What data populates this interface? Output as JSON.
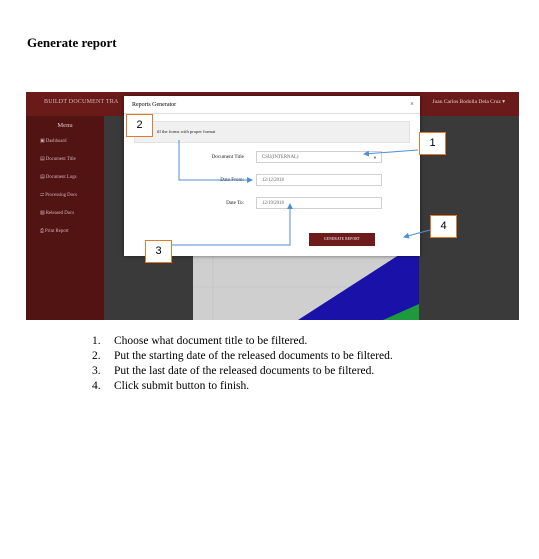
{
  "doc_heading": "Generate report",
  "app": {
    "brand": "BUILDT DOCUMENT TRA",
    "user": "Juan Carlos Bodolla Dela Cruz ▾",
    "menu_title": "Menu",
    "sidebar_items": [
      {
        "icon": "dashboard-icon",
        "glyph": "▣",
        "label": "Dashboard"
      },
      {
        "icon": "document-title-icon",
        "glyph": "▤",
        "label": "Document Title"
      },
      {
        "icon": "document-logs-icon",
        "glyph": "▤",
        "label": "Document Logs"
      },
      {
        "icon": "processing-icon",
        "glyph": "⇄",
        "label": "Processing Docs"
      },
      {
        "icon": "released-icon",
        "glyph": "▧",
        "label": "Released Docs"
      },
      {
        "icon": "print-icon",
        "glyph": "⎙",
        "label": "Print Report"
      }
    ]
  },
  "modal": {
    "title": "Reports Generator",
    "close": "×",
    "notice": "ill the forms with proper format",
    "document_title_label": "Document Title",
    "document_title_value": "CSU(INTERNAL)",
    "date_from_label": "Date From:",
    "date_from_value": "12/12/2018",
    "date_to_label": "Date To:",
    "date_to_value": "12/19/2018",
    "generate_button": "GENERATE REPORT"
  },
  "colors": {
    "maroon": "#6b1a1a",
    "callout_border": "#e07b2e",
    "arrow": "#4f8fd6",
    "chart_blue": "#1a12a8",
    "chart_green": "#1e9a3c"
  },
  "callouts": [
    "1",
    "2",
    "3",
    "4"
  ],
  "steps": [
    {
      "num": "1.",
      "text": "Choose what document title to be filtered."
    },
    {
      "num": "2.",
      "text": "Put the starting date of the released documents to be filtered."
    },
    {
      "num": "3.",
      "text": "Put the last date of the released documents to be filtered."
    },
    {
      "num": "4.",
      "text": "Click submit button to finish."
    }
  ]
}
